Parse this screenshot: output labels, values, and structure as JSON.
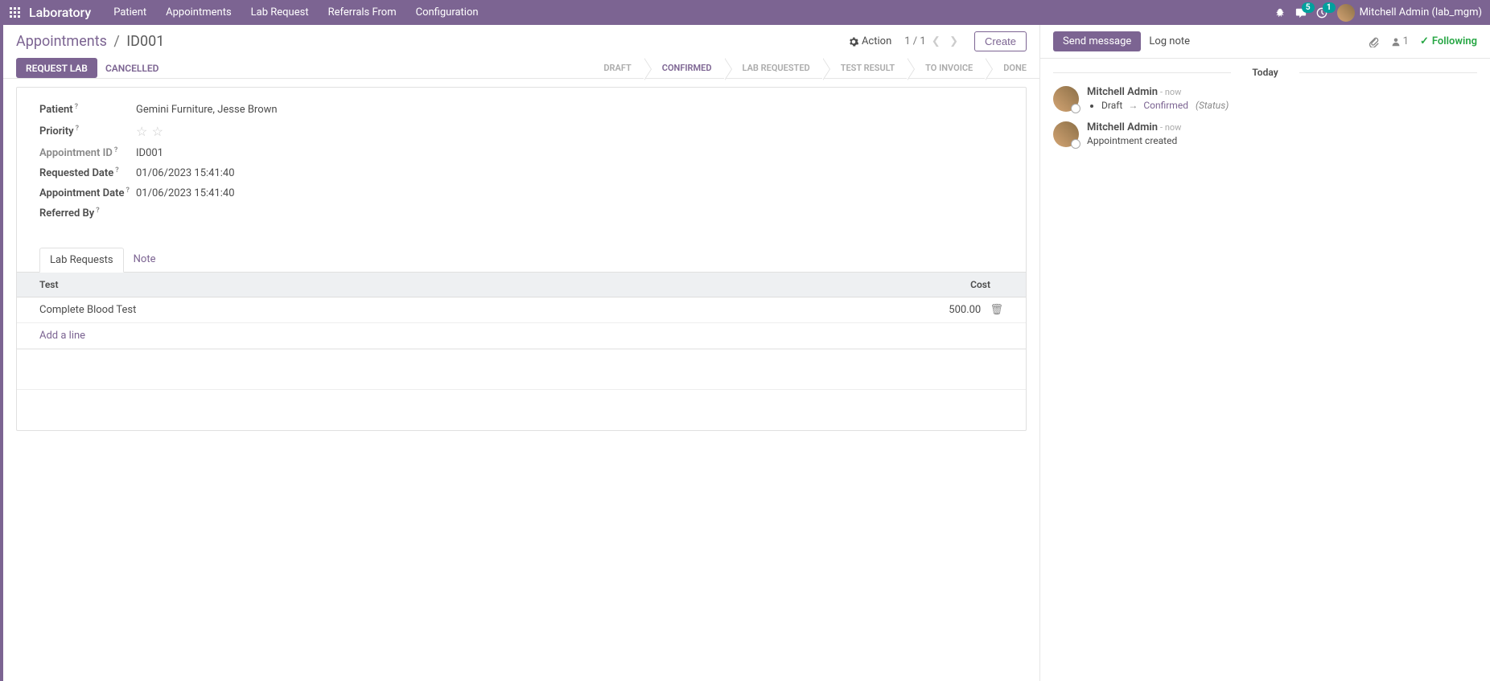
{
  "topbar": {
    "brand": "Laboratory",
    "nav": [
      "Patient",
      "Appointments",
      "Lab Request",
      "Referrals From",
      "Configuration"
    ],
    "chat_badge": "5",
    "activity_badge": "1",
    "user_display": "Mitchell Admin (lab_mgm)"
  },
  "breadcrumb": {
    "parent": "Appointments",
    "current": "ID001"
  },
  "controlbar": {
    "action_label": "Action",
    "pager": "1 / 1",
    "create_label": "Create"
  },
  "workflow_buttons": {
    "request_lab": "REQUEST LAB",
    "cancelled": "CANCELLED"
  },
  "status_steps": [
    "DRAFT",
    "CONFIRMED",
    "LAB REQUESTED",
    "TEST RESULT",
    "TO INVOICE",
    "DONE"
  ],
  "active_status_index": 1,
  "form": {
    "patient_label": "Patient",
    "patient_value": "Gemini Furniture, Jesse Brown",
    "priority_label": "Priority",
    "appointment_id_label": "Appointment ID",
    "appointment_id_value": "ID001",
    "requested_date_label": "Requested Date",
    "requested_date_value": "01/06/2023 15:41:40",
    "appointment_date_label": "Appointment Date",
    "appointment_date_value": "01/06/2023 15:41:40",
    "referred_by_label": "Referred By",
    "referred_by_value": ""
  },
  "tabs": {
    "lab_requests": "Lab Requests",
    "note": "Note"
  },
  "lab_table": {
    "col_test": "Test",
    "col_cost": "Cost",
    "rows": [
      {
        "test": "Complete Blood Test",
        "cost": "500.00"
      }
    ],
    "add_line": "Add a line"
  },
  "chatter": {
    "send_message": "Send message",
    "log_note": "Log note",
    "followers_count": "1",
    "following_label": "Following",
    "day_label": "Today",
    "messages": [
      {
        "author": "Mitchell Admin",
        "time": "now",
        "type": "status",
        "from": "Draft",
        "to": "Confirmed",
        "field": "(Status)"
      },
      {
        "author": "Mitchell Admin",
        "time": "now",
        "type": "text",
        "body": "Appointment created"
      }
    ]
  }
}
